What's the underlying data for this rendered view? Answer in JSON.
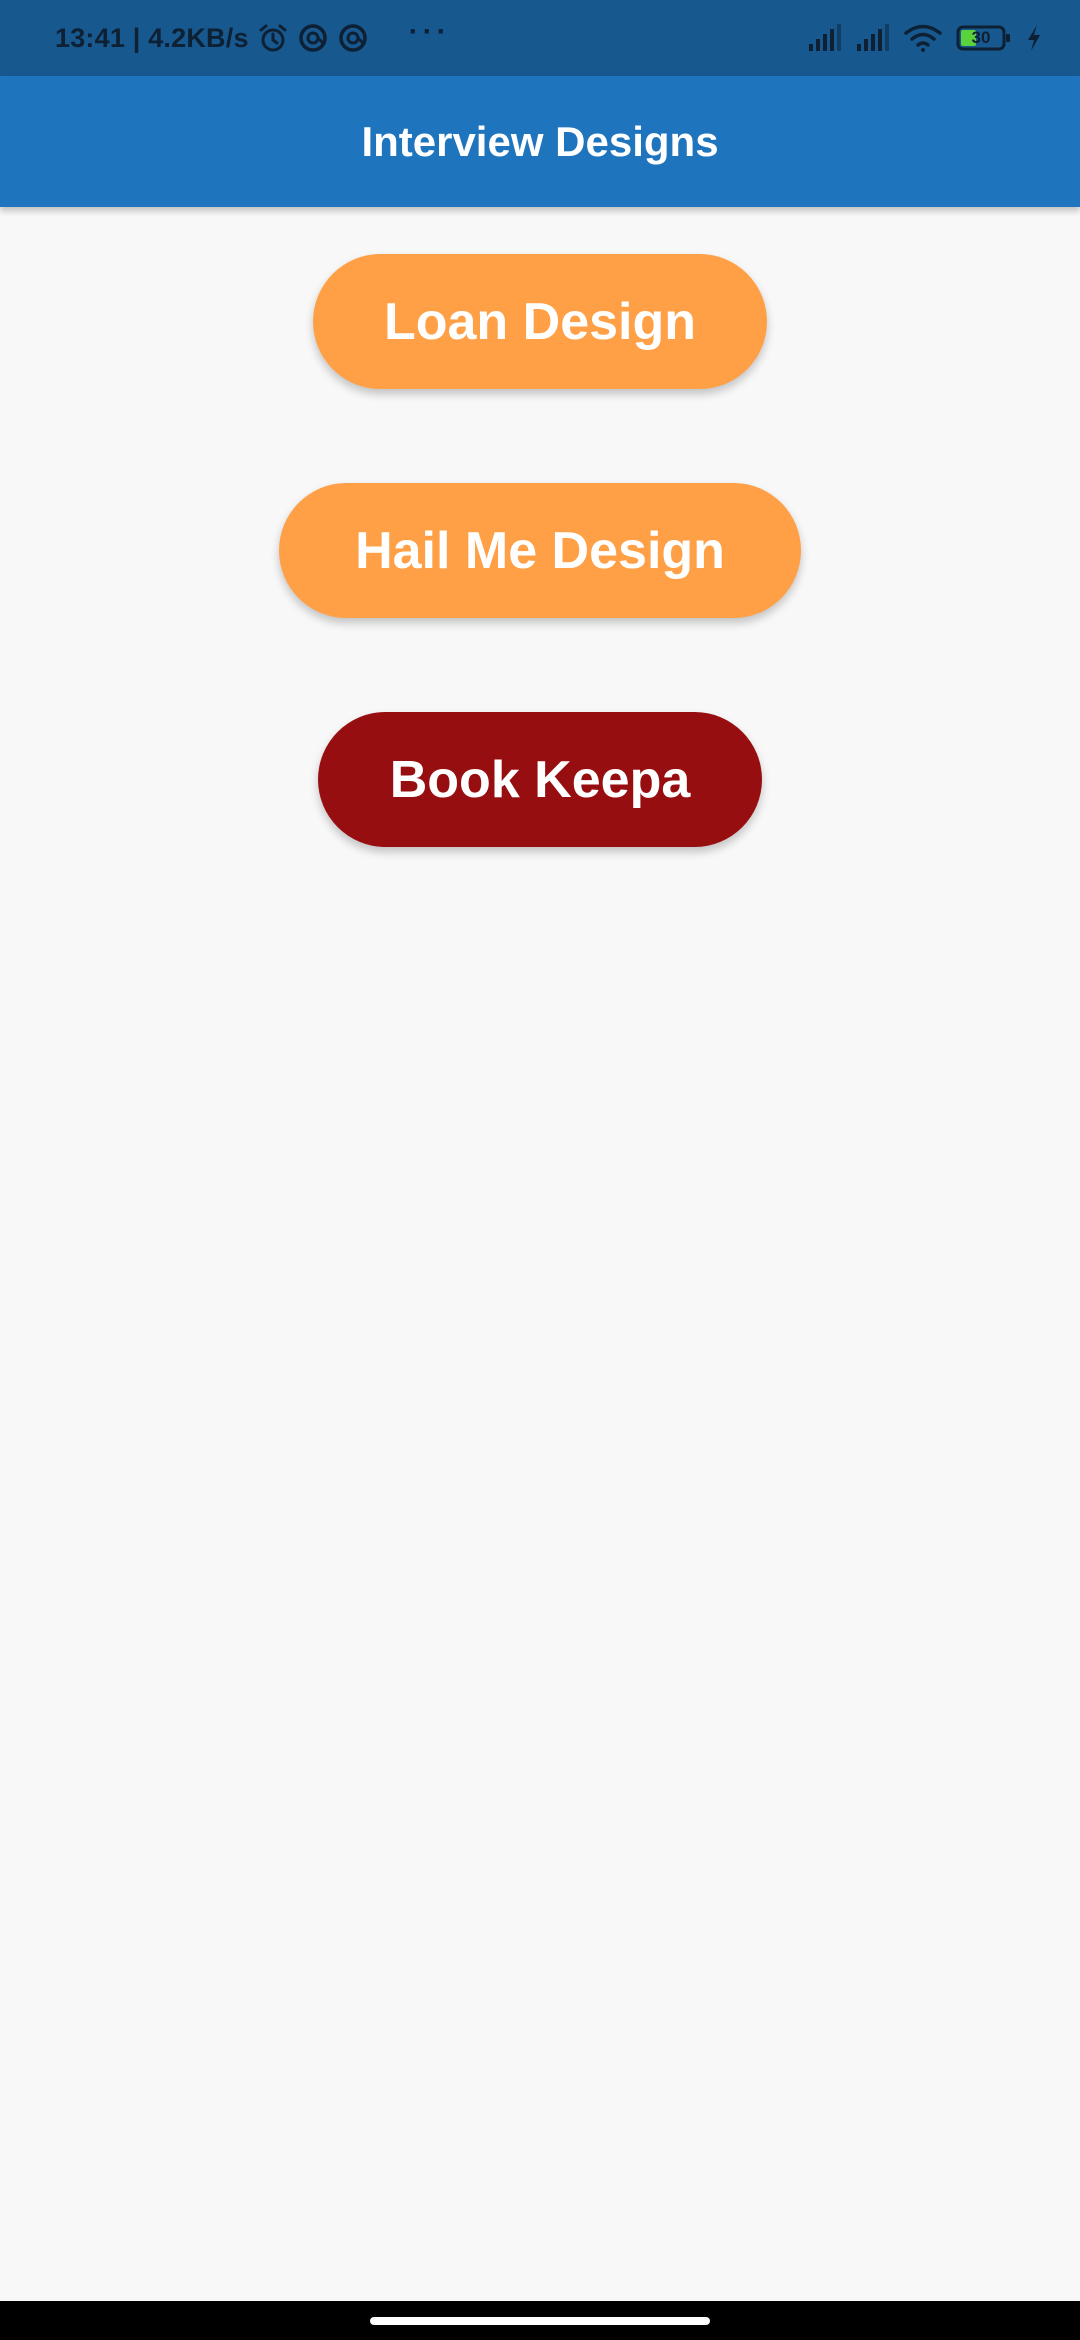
{
  "status_bar": {
    "time_speed": "13:41 | 4.2KB/s",
    "icons": [
      "alarm-icon",
      "sync-icon",
      "sync-icon",
      "more-dots-icon",
      "cell-signal-icon",
      "cell-signal-icon",
      "wifi-icon",
      "battery-icon",
      "charging-icon"
    ],
    "more_dots": "···",
    "battery_level": "30",
    "color": "#17588f"
  },
  "app_bar": {
    "title": "Interview Designs",
    "color": "#1e74bd"
  },
  "buttons": {
    "loan": {
      "label": "Loan Design",
      "color": "#ffa046"
    },
    "hail": {
      "label": "Hail Me Design",
      "color": "#ffa046"
    },
    "book": {
      "label": "Book Keepa",
      "color": "#970e11"
    }
  },
  "page": {
    "background": "#f8f8f8"
  }
}
